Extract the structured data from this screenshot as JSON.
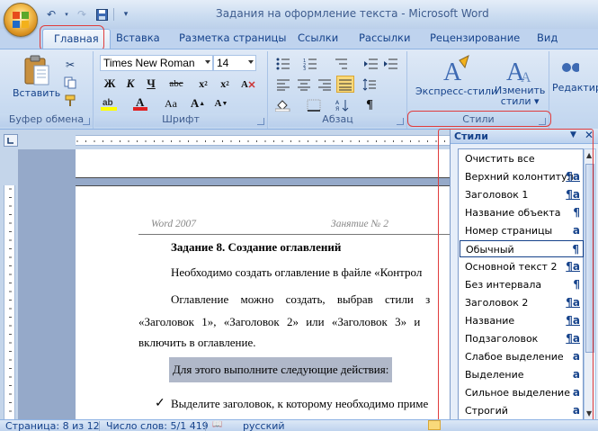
{
  "window": {
    "title": "Задания на оформление текста - Microsoft Word"
  },
  "tabs": [
    {
      "label": "Главная",
      "active": true
    },
    {
      "label": "Вставка"
    },
    {
      "label": "Разметка страницы"
    },
    {
      "label": "Ссылки"
    },
    {
      "label": "Рассылки"
    },
    {
      "label": "Рецензирование"
    },
    {
      "label": "Вид"
    }
  ],
  "ribbon": {
    "clipboard": {
      "label": "Буфер обмена",
      "paste_label": "Вставить"
    },
    "font": {
      "label": "Шрифт",
      "font_name": "Times New Roman",
      "font_size": "14"
    },
    "paragraph": {
      "label": "Абзац"
    },
    "styles": {
      "label": "Стили",
      "express_label": "Экспресс-стили",
      "change_label_1": "Изменить",
      "change_label_2": "стили"
    },
    "editing": {
      "label": "Редактир"
    }
  },
  "document": {
    "header_left": "Word 2007",
    "header_right": "Занятие № 2",
    "heading": "Задание 8. Создание оглавлений",
    "p1": "Необходимо создать оглавление в файле «Контрол",
    "p2_a": "Оглавление можно создать, выбрав стили з",
    "p2_b": "«Заголовок 1», «Заголовок 2» или «Заголовок 3» и",
    "p2_c": "включить в оглавление.",
    "highlight": "Для этого выполните следующие действия:",
    "bullet": "Выделите заголовок, к которому необходимо приме"
  },
  "styles_pane": {
    "title": "Стили",
    "items": [
      {
        "name": "Очистить все",
        "mark": ""
      },
      {
        "name": "Верхний колонтитул",
        "mark": "¶a"
      },
      {
        "name": "Заголовок 1",
        "mark": "¶a"
      },
      {
        "name": "Название объекта",
        "mark": "¶"
      },
      {
        "name": "Номер страницы",
        "mark": "a"
      },
      {
        "name": "Обычный",
        "mark": "¶",
        "selected": true
      },
      {
        "name": "Основной текст 2",
        "mark": "¶a"
      },
      {
        "name": "Без интервала",
        "mark": "¶"
      },
      {
        "name": "Заголовок 2",
        "mark": "¶a"
      },
      {
        "name": "Название",
        "mark": "¶a"
      },
      {
        "name": "Подзаголовок",
        "mark": "¶a"
      },
      {
        "name": "Слабое выделение",
        "mark": "a"
      },
      {
        "name": "Выделение",
        "mark": "a"
      },
      {
        "name": "Сильное выделение",
        "mark": "a"
      },
      {
        "name": "Строгий",
        "mark": "a"
      }
    ]
  },
  "status_bar": {
    "page": "Страница: 8 из 12",
    "words": "Число слов: 5/1 419",
    "language": "русский"
  },
  "colors": {
    "accent": "#15428b",
    "highlight_red": "#e03c3c",
    "ribbon_bg": "#dfe9f6"
  },
  "icons": [
    "office-button",
    "undo-icon",
    "redo-icon",
    "save-icon",
    "paste-icon",
    "cut-icon",
    "copy-icon",
    "format-painter-icon",
    "bold-icon",
    "italic-icon",
    "underline-icon",
    "strikethrough-icon",
    "subscript-icon",
    "superscript-icon",
    "bullets-icon",
    "numbering-icon",
    "multilevel-icon",
    "align-left-icon",
    "center-icon",
    "align-right-icon",
    "justify-icon",
    "line-spacing-icon",
    "shading-icon",
    "borders-icon",
    "pilcrow-icon",
    "quick-styles-icon",
    "change-styles-icon",
    "check-bullet-icon"
  ]
}
